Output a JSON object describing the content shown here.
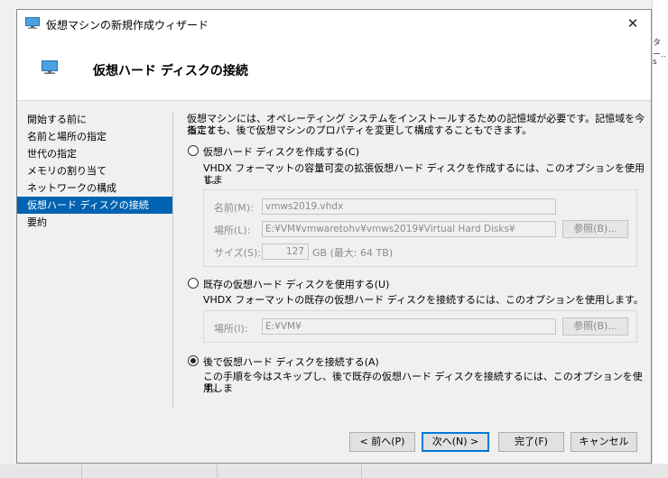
{
  "window": {
    "title": "仮想マシンの新規作成ウィザード",
    "close_glyph": "✕"
  },
  "header": {
    "title": "仮想ハード ディスクの接続"
  },
  "nav": {
    "items": [
      {
        "label": "開始する前に"
      },
      {
        "label": "名前と場所の指定"
      },
      {
        "label": "世代の指定"
      },
      {
        "label": "メモリの割り当て"
      },
      {
        "label": "ネットワークの構成"
      },
      {
        "label": "仮想ハード ディスクの接続",
        "active": true
      },
      {
        "label": "要約"
      }
    ]
  },
  "content": {
    "intro_line1": "仮想マシンには、オペレーティング システムをインストールするための記憶域が必要です。記憶域を今指定す",
    "intro_line2": "ることも、後で仮想マシンのプロパティを変更して構成することもできます。",
    "create": {
      "label": "仮想ハード ディスクを作成する(C)",
      "desc_line1": "VHDX フォーマットの容量可変の拡張仮想ハード ディスクを作成するには、このオプションを使用しま",
      "desc_line2": "す。",
      "name_label": "名前(M):",
      "name_value": "vmws2019.vhdx",
      "location_label": "場所(L):",
      "location_value": "E:¥VM¥vmwaretohv¥vmws2019¥Virtual Hard Disks¥",
      "browse_label": "参照(B)...",
      "size_label": "サイズ(S):",
      "size_value": "127",
      "size_unit": "GB (最大: 64 TB)"
    },
    "existing": {
      "label": "既存の仮想ハード ディスクを使用する(U)",
      "desc": "VHDX フォーマットの既存の仮想ハード ディスクを接続するには、このオプションを使用します。",
      "location_label": "場所(I):",
      "location_value": "E:¥VM¥",
      "browse_label": "参照(B)..."
    },
    "later": {
      "label": "後で仮想ハード ディスクを接続する(A)",
      "desc_line1": "この手順を今はスキップし、後で既存の仮想ハード ディスクを接続するには、このオプションを使用しま",
      "desc_line2": "す。"
    },
    "selected_option": "later"
  },
  "footer": {
    "prev_label": "< 前へ(P)",
    "next_label": "次へ(N) >",
    "finish_label": "完了(F)",
    "cancel_label": "キャンセル"
  },
  "background": {
    "frag1": "ター..",
    "frag2": "s"
  },
  "colors": {
    "accent": "#0078d7",
    "nav_selected": "#0063b1",
    "disabled_text": "#8c8c8c"
  }
}
